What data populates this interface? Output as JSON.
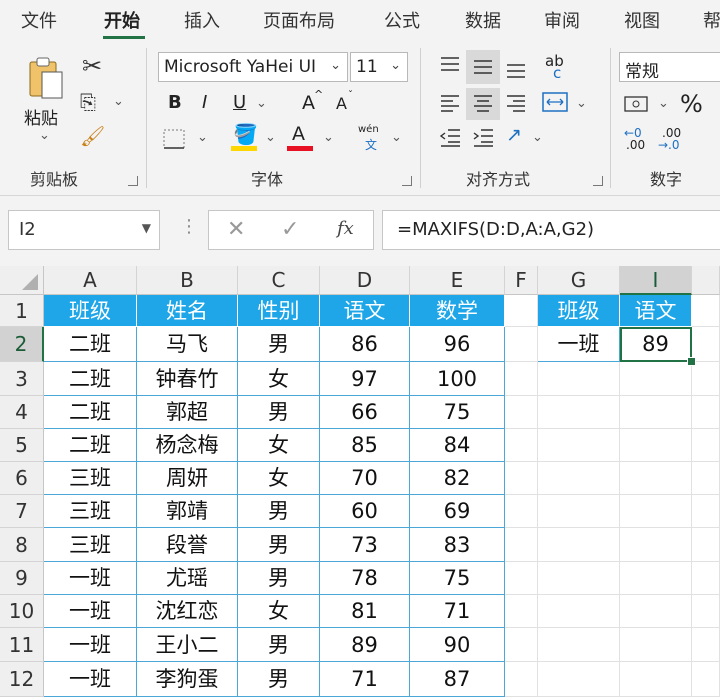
{
  "menu": {
    "tabs": [
      "文件",
      "开始",
      "插入",
      "页面布局",
      "公式",
      "数据",
      "审阅",
      "视图",
      "帮"
    ],
    "active": "开始"
  },
  "ribbon": {
    "clipboard": {
      "paste_label": "粘贴",
      "group_label": "剪贴板"
    },
    "font": {
      "font_name": "Microsoft YaHei UI",
      "font_size": "11",
      "bold": "B",
      "italic": "I",
      "underline": "U",
      "grow": "A",
      "shrink": "A",
      "font_color_letter": "A",
      "phonetic": "wén",
      "phonetic_char": "文",
      "group_label": "字体",
      "highlight_color": "#ffd700",
      "font_color": "#e81123"
    },
    "alignment": {
      "group_label": "对齐方式",
      "wrap": "ab",
      "wrap2": "c"
    },
    "number": {
      "format": "常规",
      "percent": "%",
      "group_label": "数字",
      "inc": "←0",
      "inc2": ".00",
      "dec": ".00",
      "dec2": "→.0"
    }
  },
  "formula_bar": {
    "name_box": "I2",
    "formula": "=MAXIFS(D:D,A:A,G2)",
    "fx": "fx"
  },
  "sheet": {
    "columns": [
      "A",
      "B",
      "C",
      "D",
      "E",
      "F",
      "G",
      "I"
    ],
    "rows": [
      "1",
      "2",
      "3",
      "4",
      "5",
      "6",
      "7",
      "8",
      "9",
      "10",
      "11",
      "12"
    ],
    "table_header": [
      "班级",
      "姓名",
      "性别",
      "语文",
      "数学"
    ],
    "table_rows": [
      [
        "二班",
        "马飞",
        "男",
        "86",
        "96"
      ],
      [
        "二班",
        "钟春竹",
        "女",
        "97",
        "100"
      ],
      [
        "二班",
        "郭超",
        "男",
        "66",
        "75"
      ],
      [
        "二班",
        "杨念梅",
        "女",
        "85",
        "84"
      ],
      [
        "三班",
        "周妍",
        "女",
        "70",
        "82"
      ],
      [
        "三班",
        "郭靖",
        "男",
        "60",
        "69"
      ],
      [
        "三班",
        "段誉",
        "男",
        "73",
        "83"
      ],
      [
        "一班",
        "尤瑶",
        "男",
        "78",
        "75"
      ],
      [
        "一班",
        "沈红恋",
        "女",
        "81",
        "71"
      ],
      [
        "一班",
        "王小二",
        "男",
        "89",
        "90"
      ],
      [
        "一班",
        "李狗蛋",
        "男",
        "71",
        "87"
      ]
    ],
    "lookup_header": [
      "班级",
      "语文"
    ],
    "lookup_row": [
      "一班",
      "89"
    ],
    "header_fill": "#1ea6e8",
    "accent": "#217346"
  }
}
